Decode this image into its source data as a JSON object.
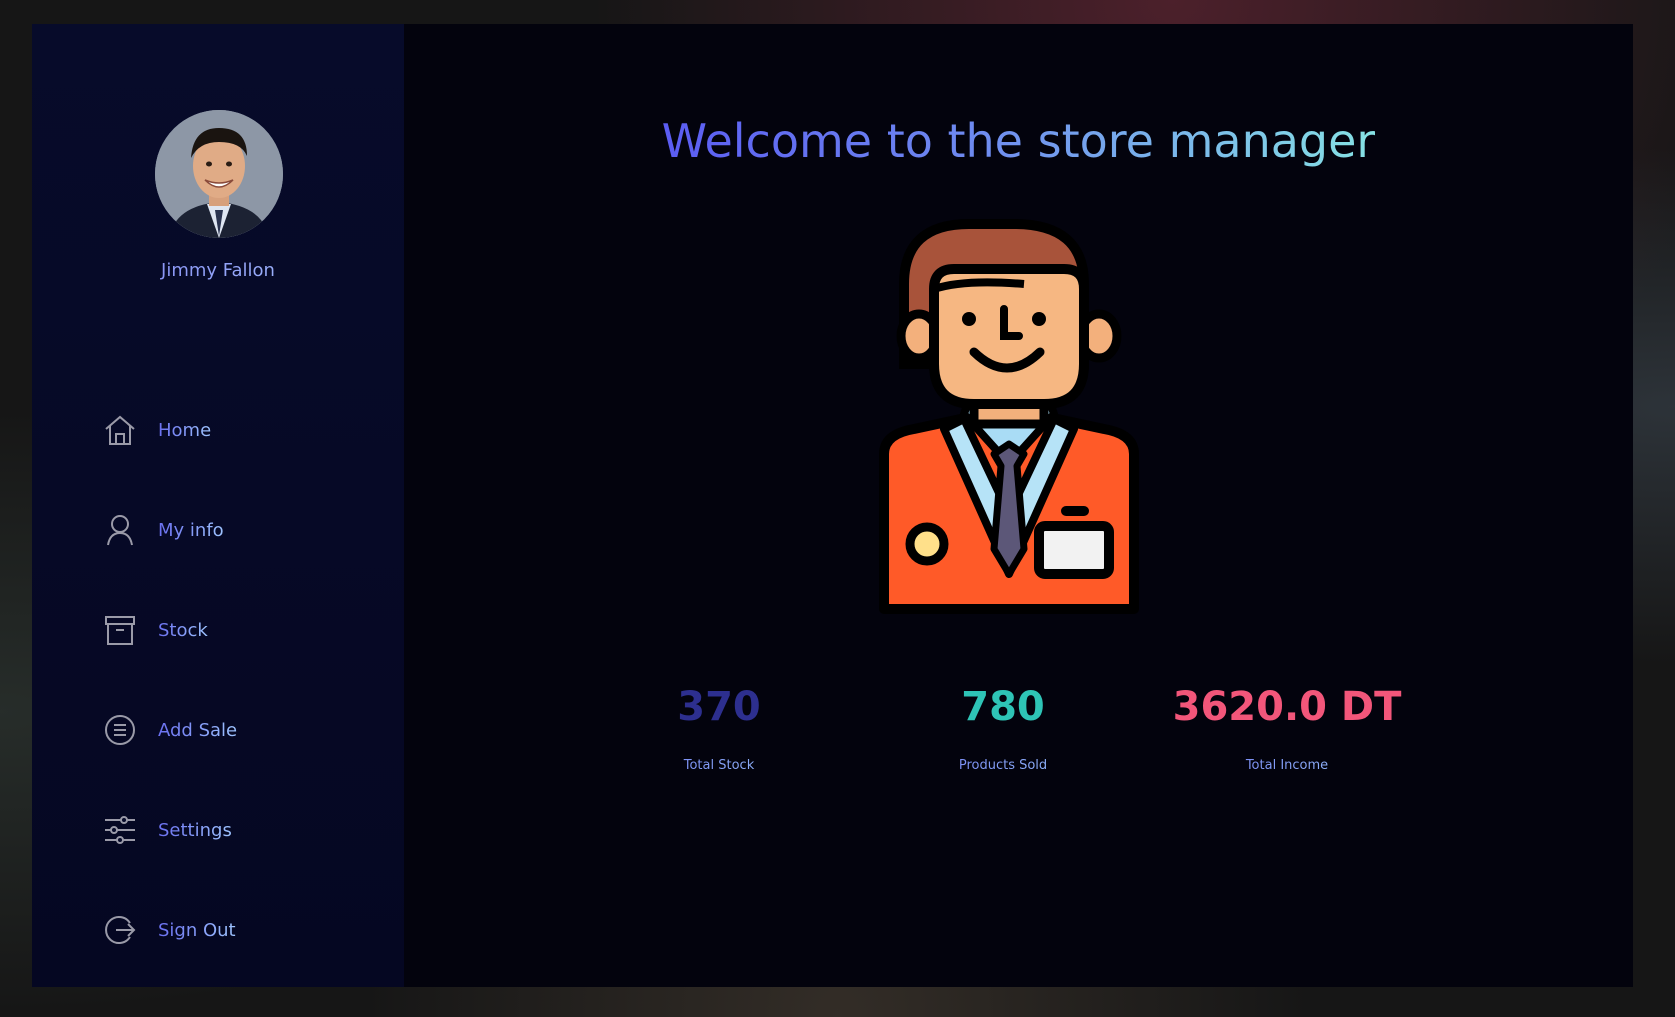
{
  "user": {
    "name": "Jimmy Fallon"
  },
  "sidebar": {
    "items": [
      {
        "label": "Home",
        "icon": "home-icon"
      },
      {
        "label": "My info",
        "icon": "user-icon"
      },
      {
        "label": "Stock",
        "icon": "archive-box-icon"
      },
      {
        "label": "Add Sale",
        "icon": "list-circle-icon"
      },
      {
        "label": "Settings",
        "icon": "sliders-icon"
      },
      {
        "label": "Sign Out",
        "icon": "sign-out-icon"
      }
    ]
  },
  "main": {
    "title": "Welcome to the store manager",
    "stats": [
      {
        "value": "370",
        "label": "Total Stock",
        "color": "#2d2f8f"
      },
      {
        "value": "780",
        "label": "Products Sold",
        "color": "#2ec4b6"
      },
      {
        "value": "3620.0 DT",
        "label": "Total Income",
        "color": "#f2567a"
      }
    ]
  },
  "colors": {
    "sidebar_bg": "#070b2a",
    "main_bg": "#03030d",
    "accent": "#6f8cf0"
  }
}
